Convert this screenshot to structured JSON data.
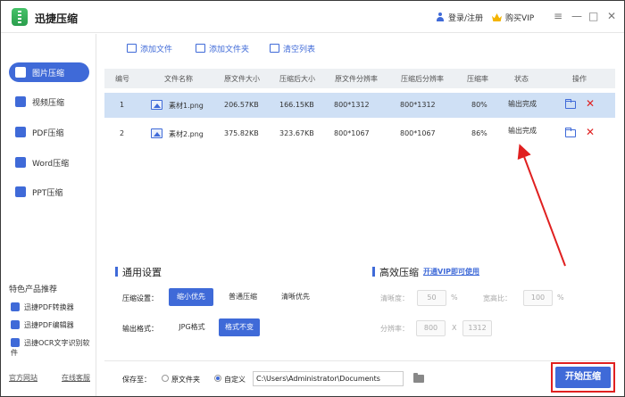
{
  "app": {
    "title": "迅捷压缩"
  },
  "header": {
    "login": "登录/注册",
    "vip": "购买VIP",
    "menu_icon": "≡",
    "minimize_icon": "—",
    "maximize_icon": "□",
    "close_icon": "✕"
  },
  "sidebar": {
    "items": [
      {
        "label": "图片压缩",
        "active": true
      },
      {
        "label": "视频压缩",
        "active": false
      },
      {
        "label": "PDF压缩",
        "active": false
      },
      {
        "label": "Word压缩",
        "active": false
      },
      {
        "label": "PPT压缩",
        "active": false
      }
    ],
    "featured_title": "特色产品推荐",
    "featured": [
      "迅捷PDF转换器",
      "迅捷PDF编辑器",
      "迅捷OCR文字识别软件"
    ],
    "links": [
      "官方网站",
      "在线客服"
    ]
  },
  "toolbar": {
    "add_file": "添加文件",
    "add_folder": "添加文件夹",
    "clear_list": "清空列表"
  },
  "table": {
    "headers": [
      "编号",
      "文件名称",
      "原文件大小",
      "压缩后大小",
      "原文件分辨率",
      "压缩后分辨率",
      "压缩率",
      "状态",
      "操作"
    ],
    "rows": [
      {
        "no": "1",
        "name": "素材1.png",
        "orig_size": "206.57KB",
        "comp_size": "166.15KB",
        "orig_res": "800*1312",
        "comp_res": "800*1312",
        "ratio": "80%",
        "status": "输出完成"
      },
      {
        "no": "2",
        "name": "素材2.png",
        "orig_size": "375.82KB",
        "comp_size": "323.67KB",
        "orig_res": "800*1067",
        "comp_res": "800*1067",
        "ratio": "86%",
        "status": "输出完成"
      }
    ],
    "delete_icon": "✕"
  },
  "settings": {
    "title": "通用设置",
    "mode_label": "压缩设置：",
    "modes": [
      "缩小优先",
      "普通压缩",
      "清晰优先"
    ],
    "format_label": "输出格式：",
    "formats": [
      "JPG格式",
      "格式不变"
    ]
  },
  "advanced": {
    "title": "高效压缩",
    "vip_link": "开通VIP即可使用",
    "clarity_label": "清晰度：",
    "clarity_value": "50",
    "clarity_unit": "%",
    "width_label": "宽高比：",
    "width_value": "100",
    "width_unit": "%",
    "res_label": "分辨率：",
    "res_w": "800",
    "res_x": "X",
    "res_h": "1312"
  },
  "footer": {
    "save_to": "保存至：",
    "opt_original": "原文件夹",
    "opt_custom": "自定义",
    "path": "C:\\Users\\Administrator\\Documents",
    "start": "开始压缩"
  },
  "colors": {
    "accent": "#3f6ad8",
    "selected_row": "#cfe0f5",
    "annotation": "#e02020"
  }
}
